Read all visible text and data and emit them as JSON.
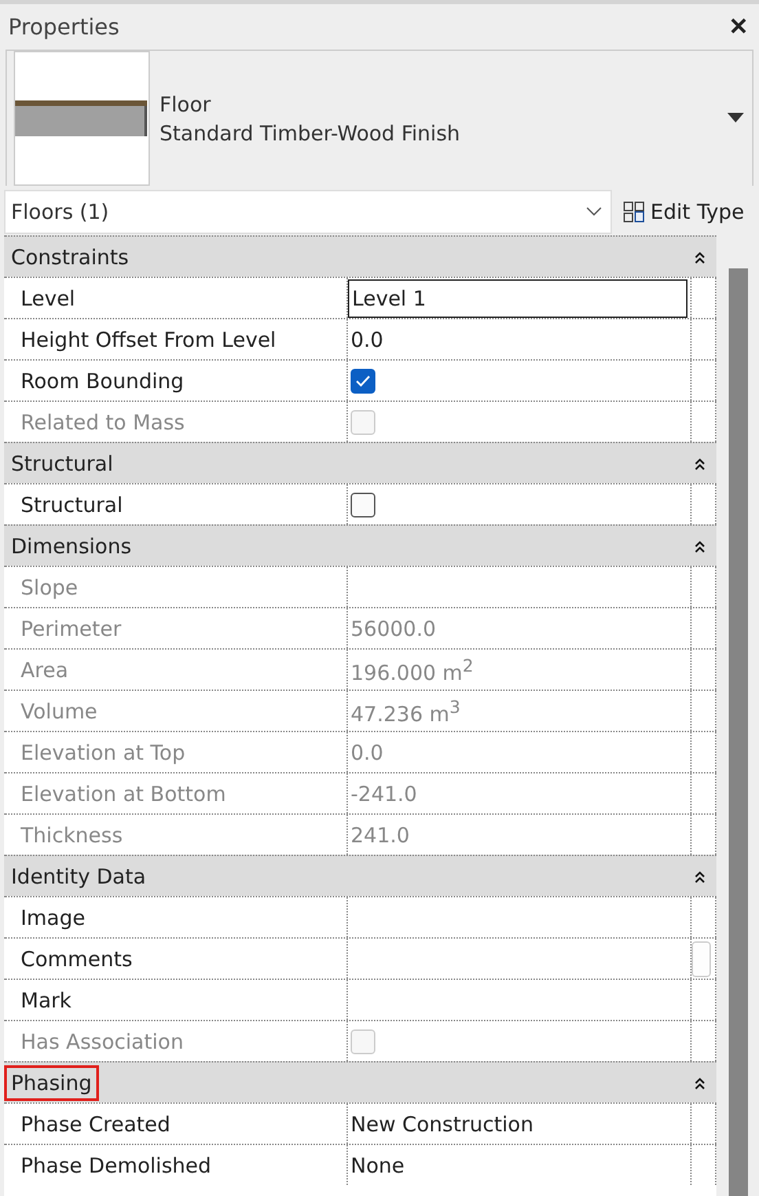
{
  "window": {
    "title": "Properties",
    "close": "✕"
  },
  "type_selector": {
    "category": "Floor",
    "type": "Standard Timber-Wood Finish"
  },
  "filter": {
    "value": "Floors (1)",
    "edit_type": "Edit Type"
  },
  "sections": [
    {
      "title": "Constraints",
      "highlighted": false,
      "rows": [
        {
          "kind": "text",
          "label": "Level",
          "value": "Level 1",
          "disabled": false,
          "editing": true
        },
        {
          "kind": "text",
          "label": "Height Offset From Level",
          "value": "0.0",
          "disabled": false,
          "editing": false
        },
        {
          "kind": "check",
          "label": "Room Bounding",
          "checked": true,
          "disabled": false
        },
        {
          "kind": "check",
          "label": "Related to Mass",
          "checked": false,
          "disabled": true
        }
      ]
    },
    {
      "title": "Structural",
      "highlighted": false,
      "rows": [
        {
          "kind": "check",
          "label": "Structural",
          "checked": false,
          "disabled": false
        }
      ]
    },
    {
      "title": "Dimensions",
      "highlighted": false,
      "rows": [
        {
          "kind": "text",
          "label": "Slope",
          "disabled": true,
          "editing": false
        },
        {
          "kind": "text",
          "label": "Perimeter",
          "value": "56000.0",
          "disabled": true,
          "editing": false
        },
        {
          "kind": "text",
          "label": "Area",
          "value": "196.000 m$^{2}$",
          "disabled": true,
          "editing": false
        },
        {
          "kind": "text",
          "label": "Volume",
          "value": "47.236 m$^{3}$",
          "disabled": true,
          "editing": false
        },
        {
          "kind": "text",
          "label": "Elevation at Top",
          "value": "0.0",
          "disabled": true,
          "editing": false
        },
        {
          "kind": "text",
          "label": "Elevation at Bottom",
          "value": "-241.0",
          "disabled": true,
          "editing": false
        },
        {
          "kind": "text",
          "label": "Thickness",
          "value": "241.0",
          "disabled": true,
          "editing": false
        }
      ]
    },
    {
      "title": "Identity Data",
      "highlighted": false,
      "rows": [
        {
          "kind": "text",
          "label": "Image",
          "disabled": false,
          "editing": false
        },
        {
          "kind": "browse",
          "label": "Comments",
          "disabled": false
        },
        {
          "kind": "text",
          "label": "Mark",
          "disabled": false,
          "editing": false
        },
        {
          "kind": "check",
          "label": "Has Association",
          "checked": false,
          "disabled": true
        }
      ]
    },
    {
      "title": "Phasing",
      "highlighted": true,
      "rows": [
        {
          "kind": "text",
          "label": "Phase Created",
          "value": "New Construction",
          "disabled": false,
          "editing": false
        },
        {
          "kind": "text",
          "label": "Phase Demolished",
          "value": "None",
          "disabled": false,
          "editing": false
        }
      ]
    }
  ]
}
